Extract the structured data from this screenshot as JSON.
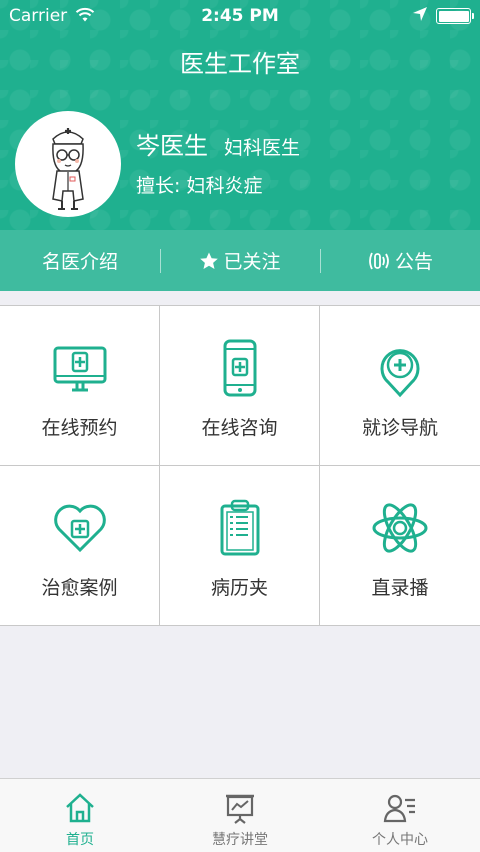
{
  "status_bar": {
    "carrier": "Carrier",
    "time": "2:45 PM"
  },
  "nav": {
    "title": "医生工作室"
  },
  "doctor": {
    "name": "岑医生",
    "title": "妇科医生",
    "specialty": "擅长: 妇科炎症"
  },
  "tabs": [
    {
      "label": "名医介绍"
    },
    {
      "label": "已关注",
      "icon": "star-icon"
    },
    {
      "label": "公告",
      "icon": "broadcast-icon"
    }
  ],
  "grid": [
    {
      "label": "在线预约",
      "icon": "monitor-plus-icon"
    },
    {
      "label": "在线咨询",
      "icon": "phone-plus-icon"
    },
    {
      "label": "就诊导航",
      "icon": "location-plus-icon"
    },
    {
      "label": "治愈案例",
      "icon": "heart-plus-icon"
    },
    {
      "label": "病历夹",
      "icon": "clipboard-icon"
    },
    {
      "label": "直录播",
      "icon": "atom-icon"
    }
  ],
  "tabbar": [
    {
      "label": "首页",
      "icon": "home-icon",
      "active": true
    },
    {
      "label": "慧疗讲堂",
      "icon": "presentation-icon",
      "active": false
    },
    {
      "label": "个人中心",
      "icon": "user-icon",
      "active": false
    }
  ],
  "colors": {
    "accent": "#1fb08f",
    "tab_strip": "#3fbb9f",
    "background": "#efeff4"
  }
}
